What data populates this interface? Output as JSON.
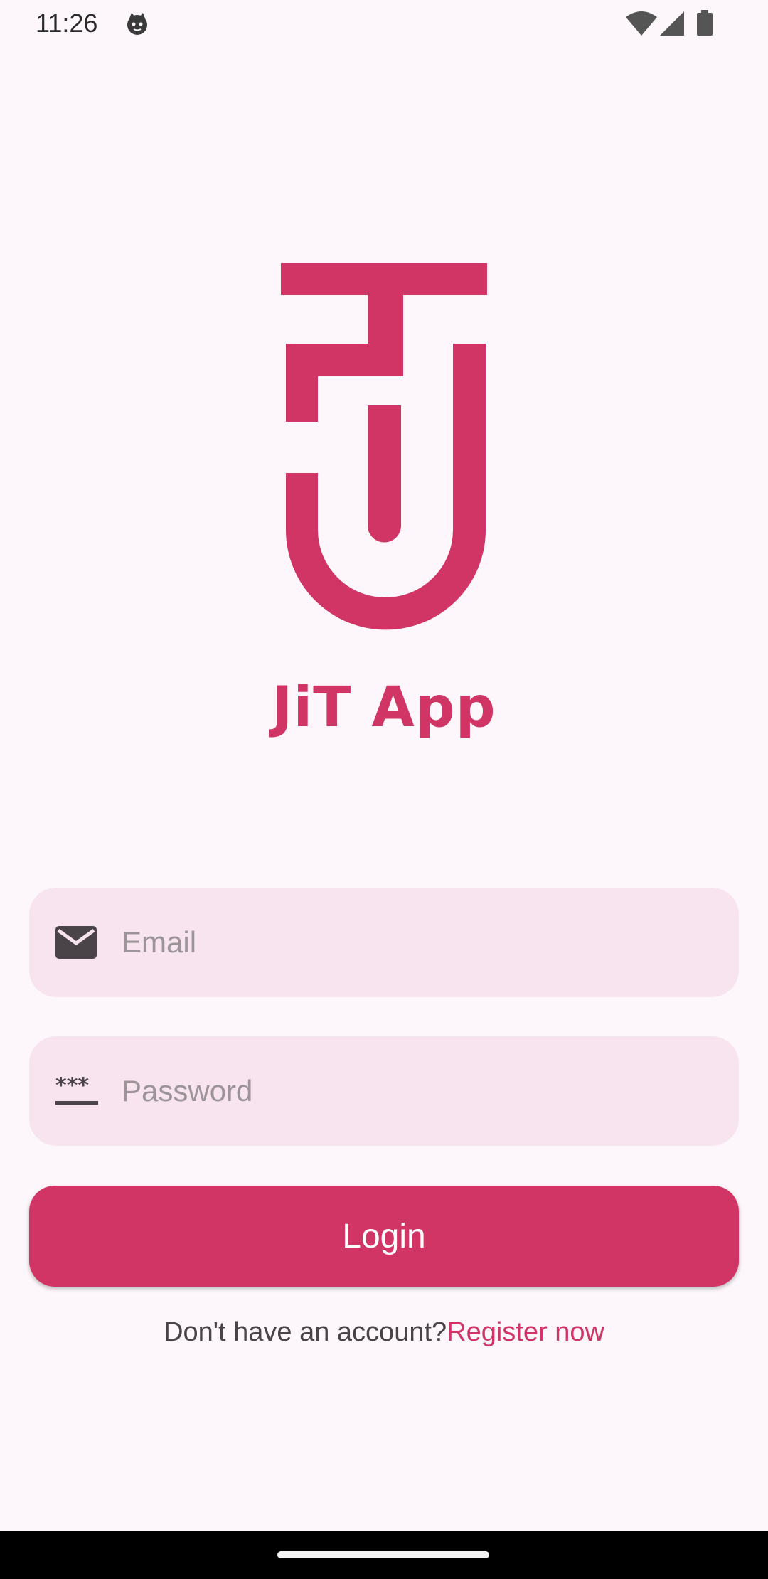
{
  "status_bar": {
    "time": "11:26"
  },
  "app": {
    "name": "JiT App",
    "brand_color": "#d13566"
  },
  "login_form": {
    "email": {
      "placeholder": "Email",
      "value": "",
      "icon": "mail-icon"
    },
    "password": {
      "placeholder": "Password",
      "value": "",
      "icon": "password-icon"
    },
    "login_label": "Login",
    "register_prompt": "Don't have an account?",
    "register_link": "Register now"
  }
}
